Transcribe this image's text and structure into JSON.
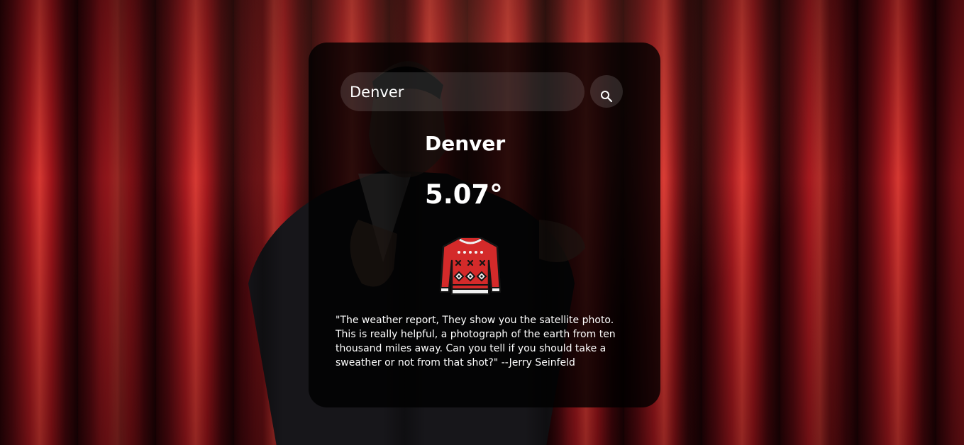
{
  "search": {
    "value": "Denver",
    "button_icon": "search-icon"
  },
  "weather": {
    "city": "Denver",
    "temperature": "5.07°",
    "icon": "sweater-icon"
  },
  "quote": "\"The weather report, They show you the satellite photo. This is really helpful, a photograph of the earth from ten thousand miles away. Can you tell if you should take a sweather or not from that shot?\" --Jerry Seinfeld",
  "colors": {
    "curtain": "#b01a20",
    "card_overlay": "#000000",
    "sweater_red": "#d42a2a",
    "text": "#ffffff"
  }
}
